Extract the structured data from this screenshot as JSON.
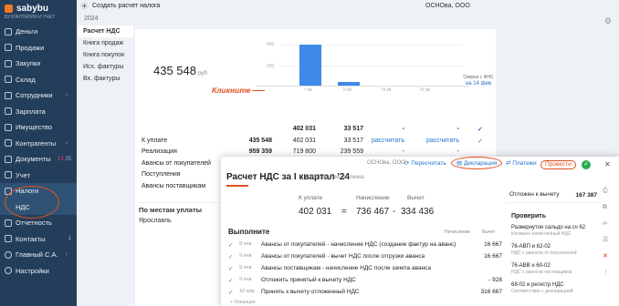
{
  "app": {
    "logo": "sabybu",
    "sub": "БУХГАЛТЕРИЯ И УЧЕТ"
  },
  "sidebar": [
    {
      "label": "Деньги",
      "chev": ""
    },
    {
      "label": "Продажи",
      "chev": ""
    },
    {
      "label": "Закупки",
      "chev": ""
    },
    {
      "label": "Склад",
      "chev": ""
    },
    {
      "label": "Сотрудники",
      "chev": "›"
    },
    {
      "label": "Зарплата",
      "chev": ""
    },
    {
      "label": "Имущество",
      "chev": ""
    },
    {
      "label": "Контрагенты",
      "chev": "›"
    },
    {
      "label": "Документы",
      "badge_a": "13",
      "badge_b": "25"
    },
    {
      "label": "Учет",
      "chev": ""
    },
    {
      "label": "Налоги",
      "chev": ""
    },
    {
      "label": "НДС",
      "chev": ""
    },
    {
      "label": "Отчетность",
      "chev": ""
    },
    {
      "label": "Контакты",
      "badge": "1"
    },
    {
      "label": "Главный С.А.",
      "chev": "›"
    },
    {
      "label": "Настройки",
      "chev": ""
    }
  ],
  "top": {
    "create": "Создать расчет налога",
    "org": "ОСНОва, ООО",
    "year": "2024"
  },
  "subnav": [
    "Расчет НДС",
    "Книга продаж",
    "Книга покупок",
    "Исх. фактуры",
    "Вх. фактуры"
  ],
  "summary": {
    "amount": "435 548",
    "unit": "руб",
    "quarters": [
      "I кв",
      "II кв",
      "III кв",
      "IV кв"
    ],
    "reconcile": "Сверка с ФНС",
    "reconcile_date": "на 14 фев",
    "click": "Кликните"
  },
  "chart_data": {
    "type": "bar",
    "categories": [
      "I кв",
      "II кв",
      "III кв",
      "IV кв"
    ],
    "values": [
      402031,
      33517,
      0,
      0
    ],
    "yticks": [
      "400",
      "200"
    ],
    "ylim": [
      0,
      400000
    ]
  },
  "table": [
    {
      "c0": "",
      "c1": "",
      "c2": "402 031",
      "c3": "33 517",
      "c4": "-",
      "c5": "-",
      "c6": "✓"
    },
    {
      "c0": "К уплате",
      "c1": "435 548",
      "c2": "402 031",
      "c3": "33 517",
      "c4": "рассчитать",
      "c5": "рассчитать",
      "c6": "✓"
    },
    {
      "c0": "Реализация",
      "c1": "959 359",
      "c2": "719 800",
      "c3": "239 559",
      "c4": "-",
      "c5": "-",
      "c6": ""
    },
    {
      "c0": "Авансы от покупателей",
      "c1": "81 667",
      "c2": "0",
      "c3": "81 667",
      "c4": "-",
      "c5": "-",
      "c6": ""
    },
    {
      "c0": "Поступления",
      "c1": "- 605 477",
      "c2": "- 317 769",
      "c3": "- 287 708",
      "c4": "-",
      "c5": "-",
      "c6": ""
    },
    {
      "c0": "Авансы поставщикам",
      "c1": "",
      "c2": "",
      "c3": "",
      "c4": "",
      "c5": "",
      "c6": ""
    }
  ],
  "places": {
    "title": "По местам уплаты",
    "city": "Ярославль"
  },
  "modal": {
    "org": "ОСНОва, ООО",
    "recalc": "Пересчитать",
    "decl": "Декларация",
    "pay": "Платежи",
    "post": "Провести",
    "title": "Расчет НДС за I квартал '24",
    "limited": "Ограничен частично",
    "l_pay": "К уплате",
    "l_acc": "Начисление",
    "l_ded": "Вычет",
    "v_pay": "402 031",
    "eq": "=",
    "v_acc": "736 467",
    "minus": "-",
    "v_ded": "334 436",
    "exec": "Выполните",
    "h_acc": "Начисление",
    "h_ded": "Вычет",
    "rows": [
      {
        "d": "9 янв",
        "t": "Авансы от покупателей - начисление НДС (создание фактур на аванс)",
        "a": "16 667"
      },
      {
        "d": "9 янв",
        "t": "Авансы от покупателей - вычет НДС после отгрузки аванса",
        "a": "16 667"
      },
      {
        "d": "9 янв",
        "t": "Авансы поставщикам - начисление НДС после зачета аванса",
        "a": ""
      },
      {
        "d": "9 янв",
        "t": "Отложить принятый к вычету НДС",
        "a": "- 928"
      },
      {
        "d": "10 апр",
        "t": "Принять к вычету отложенный НДС",
        "a": "316 667"
      }
    ],
    "more": "+ Операция",
    "deferred": "Отложен к вычету",
    "deferred_v": "167 387",
    "check": "Проверить",
    "checks": [
      {
        "t": "Развернутое сальдо на сч 62",
        "g": "Излишне начисленный НДС"
      },
      {
        "t": "76-АВП и 62-02",
        "g": "НДС с авансов от покупателей"
      },
      {
        "t": "76-АВВ и 60-02",
        "g": "НДС с авансов поставщиков"
      },
      {
        "t": "68-02 и регистр НДС",
        "g": "Соответствие с декларацией"
      }
    ]
  }
}
